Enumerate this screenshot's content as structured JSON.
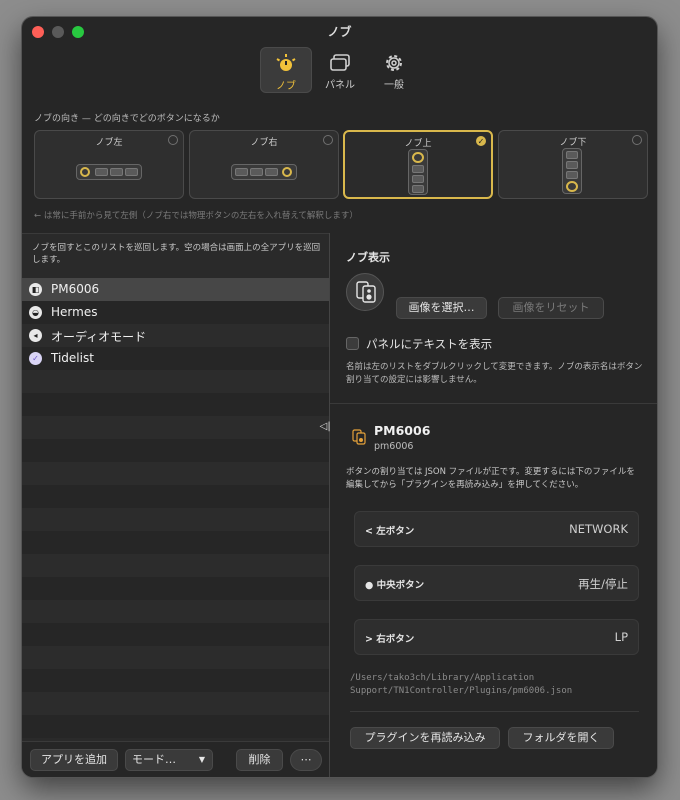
{
  "window": {
    "title": "ノブ"
  },
  "toolbar": {
    "tabs": [
      {
        "label": "ノブ",
        "icon": "knob-icon"
      },
      {
        "label": "パネル",
        "icon": "panel-icon"
      },
      {
        "label": "一般",
        "icon": "gear-icon"
      }
    ],
    "active": 0
  },
  "orientation": {
    "label": "ノブの向き — どの向きでどのボタンになるか",
    "options": [
      "ノブ左",
      "ノブ右",
      "ノブ上",
      "ノブ下"
    ],
    "selected": 2,
    "hint": "← は常に手前から見て左側（ノブ右では物理ボタンの左右を入れ替えて解釈します）"
  },
  "apps": {
    "description": "ノブを回すとこのリストを巡回します。空の場合は画面上の全アプリを巡回します。",
    "items": [
      "PM6006",
      "Hermes",
      "オーディオモード",
      "Tidelist"
    ],
    "selected": 0
  },
  "bottom": {
    "add": "アプリを追加",
    "mode": "モード…",
    "delete": "削除",
    "more": "⋯"
  },
  "display": {
    "heading": "ノブ表示",
    "select_image": "画像を選択…",
    "reset_image": "画像をリセット",
    "show_text": "パネルにテキストを表示",
    "note": "名前は左のリストをダブルクリックして変更できます。ノブの表示名はボタン割り当ての設定には影響しません。"
  },
  "plugin": {
    "name": "PM6006",
    "id": "pm6006",
    "desc": "ボタンの割り当ては JSON ファイルが正です。変更するには下のファイルを編集してから「プラグインを再読み込み」を押してください。",
    "assignments": [
      {
        "label": "< 左ボタン",
        "value": "NETWORK"
      },
      {
        "label": "● 中央ボタン",
        "value": "再生/停止"
      },
      {
        "label": "> 右ボタン",
        "value": "LP"
      }
    ],
    "path": "/Users/tako3ch/Library/Application Support/TN1Controller/Plugins/pm6006.json",
    "reload": "プラグインを再読み込み",
    "open_folder": "フォルダを開く"
  },
  "colors": {
    "accent": "#f2c23a",
    "close": "#fe5f57",
    "maximize": "#28c840"
  }
}
